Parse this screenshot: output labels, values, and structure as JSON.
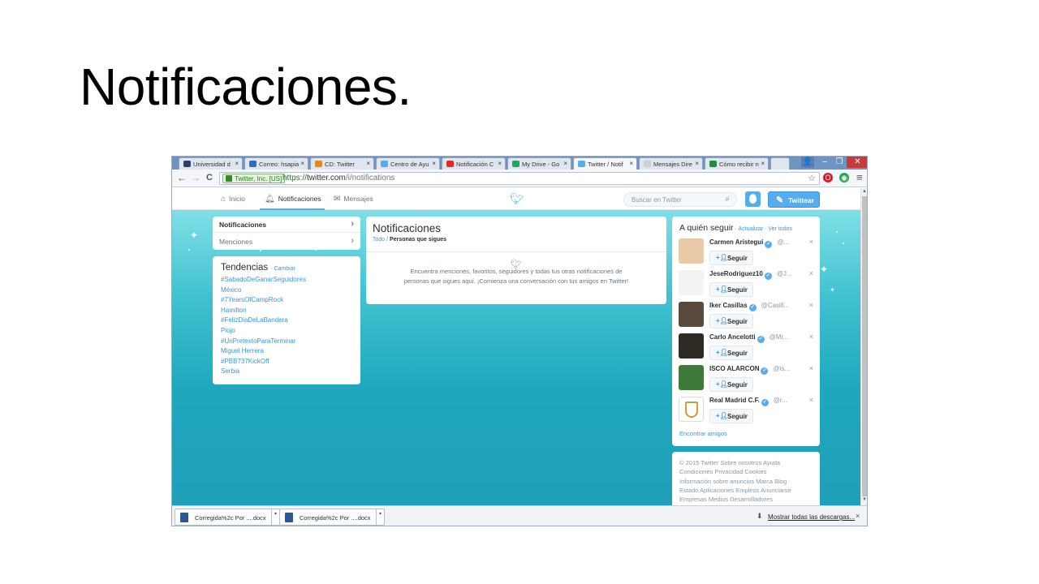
{
  "slide": {
    "title": "Notificaciones."
  },
  "browser": {
    "tabs": [
      {
        "title": "Universidad d",
        "fav": "#2d3f6b"
      },
      {
        "title": "Correo: hsapia",
        "fav": "#2a6fbd"
      },
      {
        "title": "CD: Twitter",
        "fav": "#e08a1e"
      },
      {
        "title": "Centro de Ayu",
        "fav": "#55acee"
      },
      {
        "title": "Notificación C",
        "fav": "#d93025"
      },
      {
        "title": "My Drive - Go",
        "fav": "#1fa463"
      },
      {
        "title": "Twitter / Notif",
        "fav": "#55acee"
      },
      {
        "title": "Mensajes Dire",
        "fav": "#cfcfcf"
      },
      {
        "title": "Cómo recibir n",
        "fav": "#1e8e3e"
      }
    ],
    "tab_close": "×",
    "window_controls": {
      "user": "👤",
      "minimize": "–",
      "restore": "❐",
      "close": "✕"
    },
    "nav": {
      "back": "←",
      "forward": "→",
      "reload": "C"
    },
    "security_badge": "Twitter, Inc. [US]",
    "url_scheme": "https://",
    "url_host": "twitter.com",
    "url_path": "/i/notifications",
    "bookmark_star": "☆",
    "extension_icons": [
      {
        "name": "opera-icon",
        "color": "#d91c24",
        "glyph": "O"
      },
      {
        "name": "green-circle-icon",
        "color": "#2da44e",
        "glyph": "◉"
      }
    ],
    "menu_glyph": "≡"
  },
  "twitter_nav": {
    "home": "Inicio",
    "notifications": "Notificaciones",
    "messages": "Mensajes",
    "search_placeholder": "Buscar en Twitter",
    "tweet_button": "Twittear"
  },
  "left_menu": {
    "items": [
      "Notificaciones",
      "Menciones"
    ]
  },
  "trends": {
    "title": "Tendencias",
    "change": "· Cambiar",
    "items": [
      "#SabadoDeGanarSeguidores",
      "México",
      "#7YearsOfCampRock",
      "Hamilton",
      "#FelizDiaDeLaBandera",
      "Piojo",
      "#UnPretextoParaTerminar",
      "Miguel Herrera",
      "#PBB737KickOff",
      "Serbia"
    ]
  },
  "notifications": {
    "title": "Notificaciones",
    "filter_all": "Todo",
    "filter_sep": " / ",
    "filter_following": "Personas que sigues",
    "empty_line1": "Encuentra menciones, favoritos, seguidores y todas tus otras notificaciones de",
    "empty_line2": "personas que sigues aquí. ¡Comienza una conversación con tus amigos en Twitter!"
  },
  "who_to_follow": {
    "title": "A quién seguir",
    "links": "· Actualizar · Ver todos",
    "follow_label": "Seguir",
    "dismiss": "×",
    "accounts": [
      {
        "name": "Carmen Aristegui",
        "handle": "@...",
        "avatar": "#e8c9a8"
      },
      {
        "name": "JeseRodriguez10",
        "handle": "@J...",
        "avatar": "#f3f3f3"
      },
      {
        "name": "Iker Casillas",
        "handle": "@Casill...",
        "avatar": "#5a4a3e"
      },
      {
        "name": "Carlo Ancelotti",
        "handle": "@Mr...",
        "avatar": "#2f2a24"
      },
      {
        "name": "ISCO ALARCON",
        "handle": "@is...",
        "avatar": "#3f7a3a"
      },
      {
        "name": "Real Madrid C.F.",
        "handle": "@r...",
        "avatar": "#ffffff"
      }
    ],
    "find_friends": "Encontrar amigos"
  },
  "footer": {
    "lines": [
      "© 2015 Twitter  Sobre nosotros  Ayuda",
      "Condiciones  Privacidad  Cookies",
      "Información sobre anuncios  Marca  Blog",
      "Estado  Aplicaciones  Empleos  Anunciarse",
      "Empresas  Medios  Desarrolladores"
    ]
  },
  "downloads": {
    "items": [
      "Corregida%2c Por ....docx",
      "Corregida%2c Por ....docx"
    ],
    "show_all": "Mostrar todas las descargas...",
    "close": "×"
  },
  "colors": {
    "twitter_blue": "#55acee",
    "link_blue": "#3b94d9",
    "teal_bg": "#1fa8bd"
  }
}
